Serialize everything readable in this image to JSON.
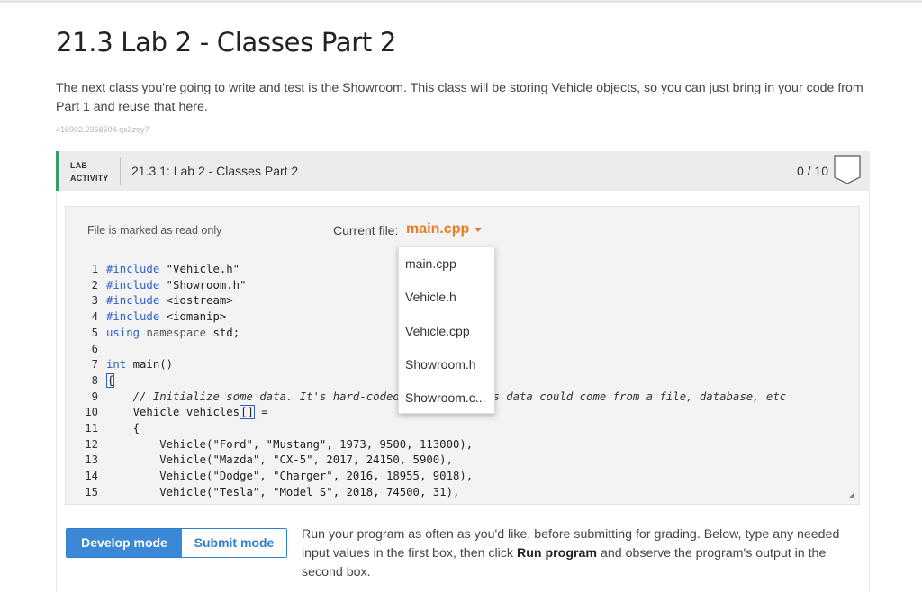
{
  "page": {
    "title": "21.3 Lab 2 - Classes Part 2",
    "description": "The next class you're going to write and test is the Showroom. This class will be storing Vehicle objects, so you can just bring in your code from Part 1 and reuse that here.",
    "hash": "416902.2358504.qx3zqy7"
  },
  "lab": {
    "tag_line1": "LAB",
    "tag_line2": "ACTIVITY",
    "name": "21.3.1: Lab 2 - Classes Part 2",
    "score": "0 / 10"
  },
  "editor": {
    "readonly_text": "File is marked as read only",
    "current_file_label": "Current file:",
    "current_file": "main.cpp",
    "code": [
      {
        "n": "1",
        "text": "#include \"Vehicle.h\""
      },
      {
        "n": "2",
        "text": "#include \"Showroom.h\""
      },
      {
        "n": "3",
        "text": "#include <iostream>"
      },
      {
        "n": "4",
        "text": "#include <iomanip>"
      },
      {
        "n": "5",
        "text": "using namespace std;"
      },
      {
        "n": "6",
        "text": ""
      },
      {
        "n": "7",
        "text": "int main()"
      },
      {
        "n": "8",
        "text": "{"
      },
      {
        "n": "9",
        "text": "    // Initialize some data. It's hard-coded here, but this data could come from a file, database, etc"
      },
      {
        "n": "10",
        "text": "    Vehicle vehicles[] ="
      },
      {
        "n": "11",
        "text": "    {"
      },
      {
        "n": "12",
        "text": "        Vehicle(\"Ford\", \"Mustang\", 1973, 9500, 113000),"
      },
      {
        "n": "13",
        "text": "        Vehicle(\"Mazda\", \"CX-5\", 2017, 24150, 5900),"
      },
      {
        "n": "14",
        "text": "        Vehicle(\"Dodge\", \"Charger\", 2016, 18955, 9018),"
      },
      {
        "n": "15",
        "text": "        Vehicle(\"Tesla\", \"Model S\", 2018, 74500, 31),"
      }
    ]
  },
  "file_dropdown": {
    "options": [
      "main.cpp",
      "Vehicle.h",
      "Vehicle.cpp",
      "Showroom.h",
      "Showroom.c..."
    ]
  },
  "mode": {
    "develop_label": "Develop mode",
    "submit_label": "Submit mode",
    "run_text_1": "Run your program as often as you'd like, before submitting for grading. Below, type any needed input values in the first box, then click ",
    "run_text_bold": "Run program",
    "run_text_2": " and observe the program's output in the second box."
  },
  "colors": {
    "accent_orange": "#e67e22",
    "button_blue": "#3a88d6",
    "lab_green": "#3a9b6b",
    "keyword_blue": "#2d5fc1"
  }
}
